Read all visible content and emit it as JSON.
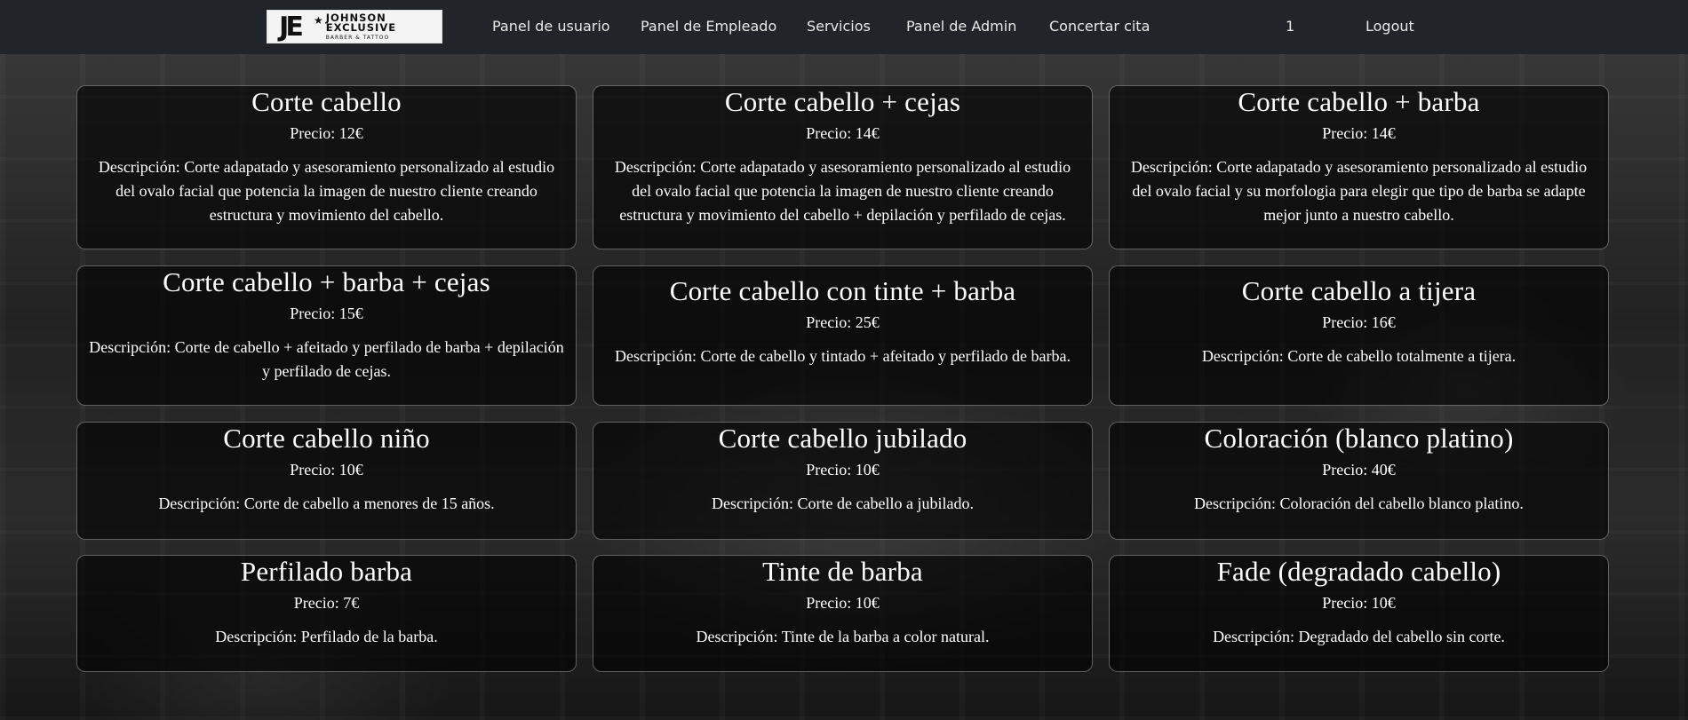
{
  "logo": {
    "mark": "JE",
    "line1": "JOHNSON",
    "line2": "EXCLUSIVE",
    "line3": "BARBER & TATTOO"
  },
  "nav": {
    "items": [
      {
        "label": "Panel de usuario"
      },
      {
        "label": "Panel de Empleado"
      },
      {
        "label": "Servicios"
      },
      {
        "label": "Panel de Admin"
      },
      {
        "label": "Concertar cita"
      },
      {
        "label": "1"
      },
      {
        "label": "Logout"
      }
    ]
  },
  "services": [
    {
      "title": "Corte cabello",
      "price": "Precio: 12€",
      "description": "Descripción: Corte adapatado y asesoramiento personalizado al estudio del ovalo facial que potencia la imagen de nuestro cliente creando estructura y movimiento del cabello."
    },
    {
      "title": "Corte cabello + cejas",
      "price": "Precio: 14€",
      "description": "Descripción: Corte adapatado y asesoramiento personalizado al estudio del ovalo facial que potencia la imagen de nuestro cliente creando estructura y movimiento del cabello + depilación y perfilado de cejas."
    },
    {
      "title": "Corte cabello + barba",
      "price": "Precio: 14€",
      "description": "Descripción: Corte adapatado y asesoramiento personalizado al estudio del ovalo facial y su morfologia para elegir que tipo de barba se adapte mejor junto a nuestro cabello."
    },
    {
      "title": "Corte cabello + barba + cejas",
      "price": "Precio: 15€",
      "description": "Descripción: Corte de cabello + afeitado y perfilado de barba + depilación y perfilado de cejas."
    },
    {
      "title": "Corte cabello con tinte + barba",
      "price": "Precio: 25€",
      "description": "Descripción: Corte de cabello y tintado + afeitado y perfilado de barba."
    },
    {
      "title": "Corte cabello a tijera",
      "price": "Precio: 16€",
      "description": "Descripción: Corte de cabello totalmente a tijera."
    },
    {
      "title": "Corte cabello niño",
      "price": "Precio: 10€",
      "description": "Descripción: Corte de cabello a menores de 15 años."
    },
    {
      "title": "Corte cabello jubilado",
      "price": "Precio: 10€",
      "description": "Descripción: Corte de cabello a jubilado."
    },
    {
      "title": "Coloración (blanco platino)",
      "price": "Precio: 40€",
      "description": "Descripción: Coloración del cabello blanco platino."
    },
    {
      "title": "Perfilado barba",
      "price": "Precio: 7€",
      "description": "Descripción: Perfilado de la barba."
    },
    {
      "title": "Tinte de barba",
      "price": "Precio: 10€",
      "description": "Descripción: Tinte de la barba a color natural."
    },
    {
      "title": "Fade (degradado cabello)",
      "price": "Precio: 10€",
      "description": "Descripción: Degradado del cabello sin corte."
    }
  ]
}
